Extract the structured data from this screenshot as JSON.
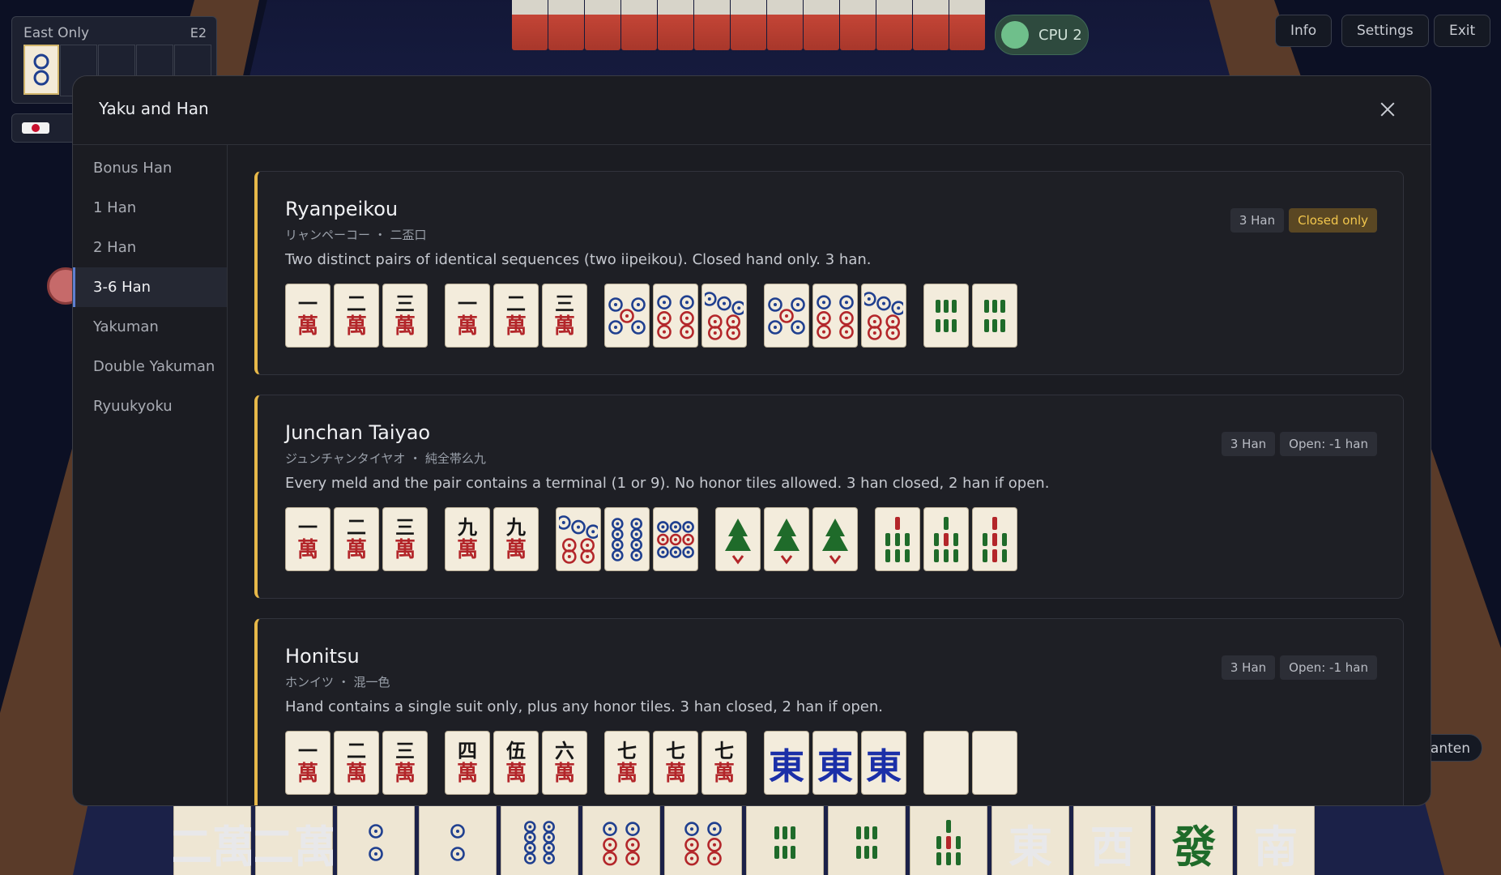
{
  "hud": {
    "round_name": "East Only",
    "round_code": "E2",
    "cpu_label": "CPU 2",
    "buttons": [
      "Info",
      "Settings",
      "Exit"
    ],
    "shanten_label": "hanten"
  },
  "modal": {
    "title": "Yaku and Han",
    "nav": [
      "Bonus Han",
      "1 Han",
      "2 Han",
      "3-6 Han",
      "Yakuman",
      "Double Yakuman",
      "Ryuukyoku"
    ],
    "active_nav": "3-6 Han",
    "cards": [
      {
        "name": "Ryanpeikou",
        "sub": "リャンペーコー ・ 二盃口",
        "desc": "Two distinct pairs of identical sequences (two iipeikou). Closed hand only. 3 han.",
        "badges": [
          "3 Han",
          "Closed only"
        ],
        "tiles": [
          [
            "1m",
            "2m",
            "3m"
          ],
          [
            "1m",
            "2m",
            "3m"
          ],
          [
            "5p",
            "6p",
            "7p"
          ],
          [
            "5p",
            "6p",
            "7p"
          ],
          [
            "6s",
            "6s"
          ]
        ]
      },
      {
        "name": "Junchan Taiyao",
        "sub": "ジュンチャンタイヤオ ・ 純全帯么九",
        "desc": "Every meld and the pair contains a terminal (1 or 9). No honor tiles allowed. 3 han closed, 2 han if open.",
        "badges": [
          "3 Han",
          "Open: -1 han"
        ],
        "tiles": [
          [
            "1m",
            "2m",
            "3m"
          ],
          [
            "9m",
            "9m"
          ],
          [
            "7p",
            "8p",
            "9p"
          ],
          [
            "1s",
            "1s",
            "1s"
          ],
          [
            "7s",
            "8s",
            "9s"
          ]
        ]
      },
      {
        "name": "Honitsu",
        "sub": "ホンイツ ・ 混一色",
        "desc": "Hand contains a single suit only, plus any honor tiles. 3 han closed, 2 han if open.",
        "badges": [
          "3 Han",
          "Open: -1 han"
        ],
        "tiles": [
          [
            "1m",
            "2m",
            "3m"
          ],
          [
            "4m",
            "5m",
            "6m"
          ],
          [
            "7m",
            "7m",
            "7m"
          ],
          [
            "E",
            "E",
            "E"
          ],
          [
            "Wd",
            "Wd"
          ]
        ]
      }
    ]
  },
  "hand": [
    "2m",
    "2m",
    "2p",
    "2p",
    "8p",
    "6p",
    "6p",
    "6s",
    "6s",
    "8s",
    "E",
    "W",
    "Gd",
    "S"
  ],
  "colors": {
    "accent": "#e7b849",
    "closed_badge_text": "#f2c64c",
    "nav_active_bar": "#5f7fd0",
    "man_red": "#b3262a",
    "pin_blue": "#1f3f8f",
    "sou_green": "#1f6b2a",
    "wind_blue": "#1b2fa8"
  }
}
